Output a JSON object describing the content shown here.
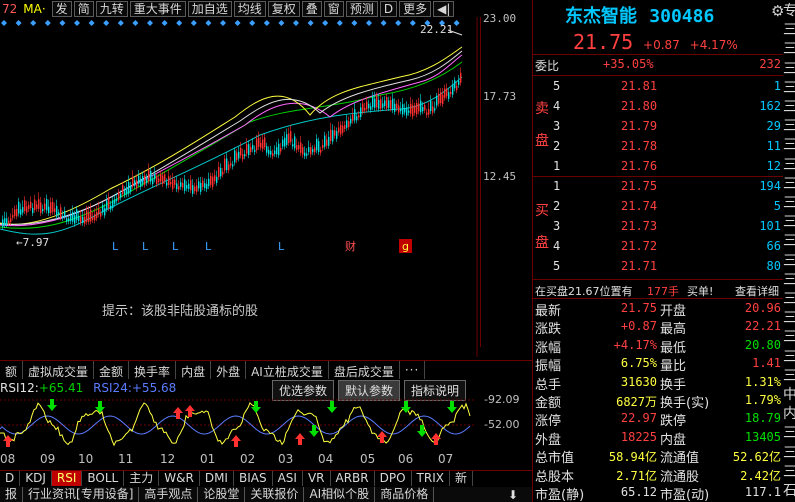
{
  "toolbar": {
    "left_tag": "72",
    "ma_label": "MA·",
    "buttons": [
      "发",
      "简",
      "九转",
      "重大事件",
      "加自选",
      "均线",
      "复权",
      "叠",
      "窗",
      "预测",
      "D",
      "更多"
    ],
    "back_arrow": "◀|"
  },
  "yaxis": {
    "labels": [
      "23.00",
      "17.73",
      "12.45"
    ],
    "rsi_labels": [
      "92.09",
      "52.00"
    ]
  },
  "chart_annotations": {
    "high_label": "22.21",
    "low_label": "7.97",
    "markers": [
      "L",
      "L",
      "L",
      "L",
      "L",
      "财",
      "g"
    ]
  },
  "hint": "提示：该股非陆股通标的股",
  "indicator_tabs": [
    "额",
    "虚拟成交量",
    "金额",
    "换手率",
    "内盘",
    "外盘",
    "AI立桩成交量",
    "盘后成交量",
    "···"
  ],
  "rsi": {
    "r12_label": "RSI12:",
    "r12_value": "+65.41",
    "r24_label": "RSI24:",
    "r24_value": "+55.68",
    "btn_opt": "优选参数",
    "btn_default": "默认参数",
    "btn_help": "指标说明"
  },
  "months": [
    "08",
    "09",
    "10",
    "11",
    "12",
    "01",
    "02",
    "03",
    "04",
    "05",
    "06",
    "07"
  ],
  "indicator_tabs2": [
    "D",
    "KDJ",
    "RSI",
    "BOLL",
    "主力",
    "W&R",
    "DMI",
    "BIAS",
    "ASI",
    "VR",
    "ARBR",
    "DPO",
    "TRIX",
    "新"
  ],
  "bottom_tabs": [
    "报",
    "行业资讯[专用设备]",
    "高手观点",
    "论股堂",
    "关联报价",
    "AI相似个股",
    "商品价格"
  ],
  "stock": {
    "name": "东杰智能",
    "code": "300486",
    "price": "21.75",
    "change": "+0.87",
    "pct": "+4.17%"
  },
  "right_edge": [
    "专",
    "三",
    "三",
    "三",
    "三",
    "三",
    "三",
    "三",
    "三",
    "三",
    "三",
    "三",
    "三",
    "三",
    "三",
    "三",
    "三",
    "三",
    "三",
    "三",
    "中",
    "内",
    "三",
    "三",
    "三",
    "石"
  ],
  "order_ratio": {
    "label": "委比",
    "pct": "+35.05%",
    "diff": "232"
  },
  "sell": [
    {
      "lvl": "5",
      "price": "21.81",
      "vol": "1"
    },
    {
      "lvl": "4",
      "price": "21.80",
      "vol": "162"
    },
    {
      "lvl": "3",
      "price": "21.79",
      "vol": "29"
    },
    {
      "lvl": "2",
      "price": "21.78",
      "vol": "11"
    },
    {
      "lvl": "1",
      "price": "21.76",
      "vol": "12"
    }
  ],
  "buy": [
    {
      "lvl": "1",
      "price": "21.75",
      "vol": "194"
    },
    {
      "lvl": "2",
      "price": "21.74",
      "vol": "5"
    },
    {
      "lvl": "3",
      "price": "21.73",
      "vol": "101"
    },
    {
      "lvl": "4",
      "price": "21.72",
      "vol": "66"
    },
    {
      "lvl": "5",
      "price": "21.71",
      "vol": "80"
    }
  ],
  "sell_label": [
    "卖",
    "盘"
  ],
  "buy_label": [
    "买",
    "盘"
  ],
  "status": {
    "text": "在买盘21.67位置有",
    "qty": "177手",
    "action": "买单!",
    "link": "查看详细"
  },
  "stats": [
    {
      "l1": "最新",
      "v1": "21.75",
      "c1": "red",
      "l2": "开盘",
      "v2": "20.96",
      "c2": "red"
    },
    {
      "l1": "涨跌",
      "v1": "+0.87",
      "c1": "red",
      "l2": "最高",
      "v2": "22.21",
      "c2": "red"
    },
    {
      "l1": "涨幅",
      "v1": "+4.17%",
      "c1": "red",
      "l2": "最低",
      "v2": "20.80",
      "c2": "green"
    },
    {
      "l1": "振幅",
      "v1": "6.75%",
      "c1": "yel",
      "l2": "量比",
      "v2": "1.41",
      "c2": "red"
    },
    {
      "l1": "总手",
      "v1": "31630",
      "c1": "yel",
      "l2": "换手",
      "v2": "1.31%",
      "c2": "yel"
    },
    {
      "l1": "金额",
      "v1": "6827万",
      "c1": "yel",
      "l2": "换手(实)",
      "v2": "1.79%",
      "c2": "yel"
    },
    {
      "l1": "涨停",
      "v1": "22.97",
      "c1": "red",
      "l2": "跌停",
      "v2": "18.79",
      "c2": "green"
    },
    {
      "l1": "外盘",
      "v1": "18225",
      "c1": "red",
      "l2": "内盘",
      "v2": "13405",
      "c2": "green"
    },
    {
      "l1": "总市值",
      "v1": "58.94亿",
      "c1": "yel",
      "l2": "流通值",
      "v2": "52.62亿",
      "c2": "yel"
    },
    {
      "l1": "总股本",
      "v1": "2.71亿",
      "c1": "yel",
      "l2": "流通股",
      "v2": "2.42亿",
      "c2": "yel"
    },
    {
      "l1": "市盈(静)",
      "v1": "65.12",
      "c1": "wht",
      "l2": "市盈(动)",
      "v2": "117.1",
      "c2": "wht"
    }
  ]
}
